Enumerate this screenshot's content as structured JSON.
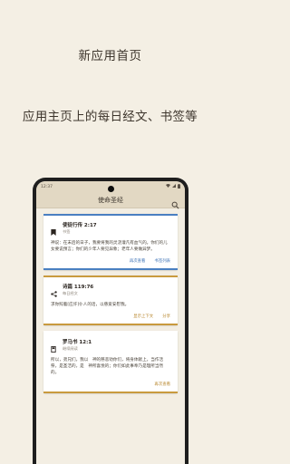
{
  "promo": {
    "title": "新应用首页",
    "subtitle": "应用主页上的每日经文、书签等"
  },
  "statusbar": {
    "time": "12:37"
  },
  "appbar": {
    "title": "使命圣经"
  },
  "colors": {
    "bookmark_accent": "#4a7fc1",
    "daily_accent": "#c99a3e",
    "reading_accent": "#c99a3e"
  },
  "cards": [
    {
      "icon": "bookmark-icon",
      "reference": "使徒行传 2:17",
      "subtitle": "书签",
      "body": "神说：在末后的日子，我要将我的灵浇灌凡有血气的。你们的儿女要说预言；你们的少年人要见异象；老年人要做异梦。",
      "actions": [
        "再次查看",
        "书签列表"
      ]
    },
    {
      "icon": "share-icon",
      "reference": "诗篇 119:76",
      "subtitle": "每日经文",
      "body": "求你照着[应许]仆人的话，以慈爱安慰我。",
      "actions": [
        "显示上下文",
        "分享"
      ]
    },
    {
      "icon": "book-icon",
      "reference": "罗马书 12:1",
      "subtitle": "继续阅读",
      "body": "所以，弟兄们，我以　神的慈悲劝你们，将身体献上，当作活祭，是圣洁的，是　神所喜悦的；你们如此事奉乃是理所当然的。",
      "actions": [
        "再次查看"
      ]
    }
  ]
}
